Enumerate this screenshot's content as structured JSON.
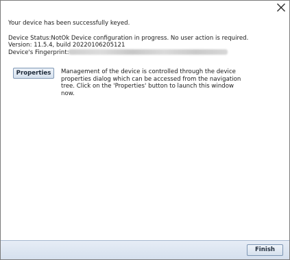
{
  "dialog": {
    "success_message": "Your device has been successfully keyed.",
    "device_status": "Device Status:NotOk Device configuration in progress. No user action is required.",
    "version": "Version: 11.5.4, build 20220106205121",
    "fingerprint_label": "Device's Fingerprint:",
    "properties_button_label": "Properties",
    "properties_description": "Management of the device is controlled through the device properties dialog which can be accessed from the navigation tree.  Click on the 'Properties' button to launch this window now.",
    "finish_button_label": "Finish"
  },
  "icons": {
    "close": "close-icon"
  },
  "colors": {
    "footer_bg": "#dce5f1",
    "button_border": "#7c95b3"
  }
}
